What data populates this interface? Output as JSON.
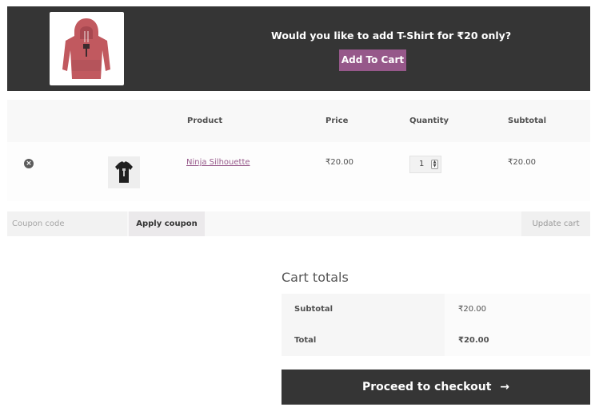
{
  "upsell": {
    "message": "Would you like to add T-Shirt for ₹20 only?",
    "button_label": "Add To Cart",
    "image_icon": "hoodie-image"
  },
  "cart": {
    "headers": {
      "product": "Product",
      "price": "Price",
      "quantity": "Quantity",
      "subtotal": "Subtotal"
    },
    "items": [
      {
        "remove_icon": "remove-icon",
        "image_icon": "tshirt-image",
        "name": "Ninja Silhouette",
        "price": "₹20.00",
        "quantity": "1",
        "subtotal": "₹20.00"
      }
    ]
  },
  "actions": {
    "coupon_placeholder": "Coupon code",
    "apply_label": "Apply coupon",
    "update_label": "Update cart"
  },
  "totals": {
    "title": "Cart totals",
    "subtotal_label": "Subtotal",
    "subtotal_value": "₹20.00",
    "total_label": "Total",
    "total_value": "₹20.00",
    "checkout_label": "Proceed to checkout",
    "checkout_arrow": "→"
  },
  "colors": {
    "dark_banner": "#353535",
    "accent_purple": "#96588a"
  }
}
